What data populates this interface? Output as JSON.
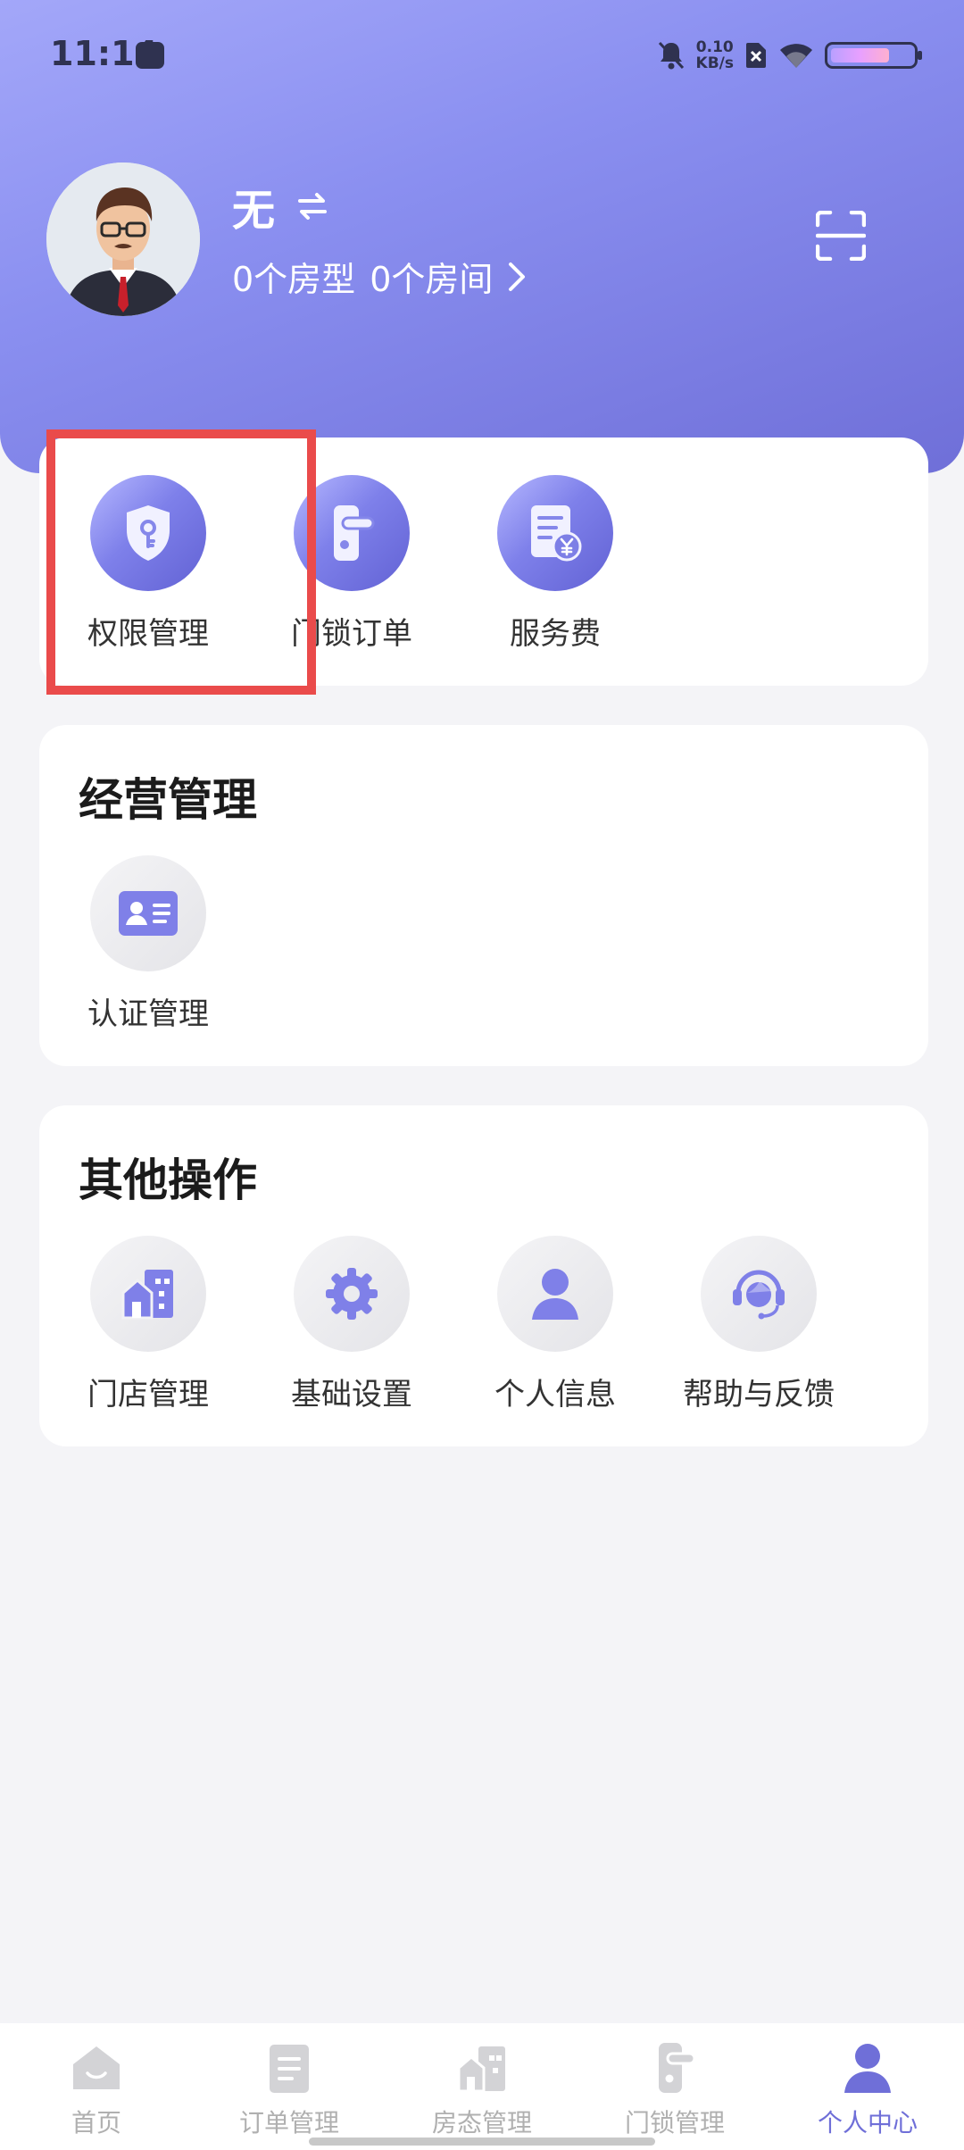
{
  "status_bar": {
    "time": "11:14",
    "network_speed_value": "0.10",
    "network_speed_unit": "KB/s",
    "battery_level": 0.72,
    "icons": [
      "shopping-bag-icon",
      "mute-bell-icon",
      "sim-off-icon",
      "wifi-icon",
      "battery-icon"
    ]
  },
  "profile": {
    "name": "无",
    "room_types": "0个房型",
    "rooms": "0个房间",
    "icons": [
      "avatar",
      "swap-icon",
      "chevron-right-icon",
      "scan-icon"
    ]
  },
  "quick_actions": [
    {
      "label": "权限管理",
      "icon": "shield-key-icon"
    },
    {
      "label": "门锁订单",
      "icon": "door-lock-icon"
    },
    {
      "label": "服务费",
      "icon": "invoice-yen-icon"
    }
  ],
  "business": {
    "title": "经营管理",
    "items": [
      {
        "label": "认证管理",
        "icon": "id-card-icon"
      }
    ]
  },
  "other": {
    "title": "其他操作",
    "items": [
      {
        "label": "门店管理",
        "icon": "store-building-icon"
      },
      {
        "label": "基础设置",
        "icon": "gear-icon"
      },
      {
        "label": "个人信息",
        "icon": "person-icon"
      },
      {
        "label": "帮助与反馈",
        "icon": "headset-icon"
      }
    ]
  },
  "bottom_nav": {
    "active": "个人中心",
    "items": [
      {
        "label": "首页",
        "icon": "home-icon"
      },
      {
        "label": "订单管理",
        "icon": "order-list-icon"
      },
      {
        "label": "房态管理",
        "icon": "room-status-icon"
      },
      {
        "label": "门锁管理",
        "icon": "door-lock-icon"
      },
      {
        "label": "个人中心",
        "icon": "profile-icon"
      }
    ]
  },
  "colors": {
    "accent": "#6f6fd8",
    "highlight": "#ea4b4b",
    "background": "#f4f4f7"
  }
}
